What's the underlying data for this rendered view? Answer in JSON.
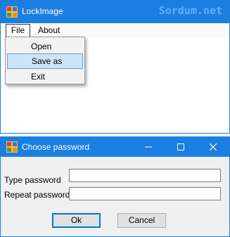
{
  "main_window": {
    "title": "LockImage",
    "watermark": "Sordum.net",
    "menu": {
      "file_label": "File",
      "about_label": "About"
    },
    "file_menu_items": [
      {
        "label": "Open",
        "selected": false
      },
      {
        "label": "Save as",
        "selected": true
      },
      {
        "label": "Exit",
        "selected": false
      }
    ]
  },
  "dialog": {
    "title": "Choose password",
    "type_password_label": "Type password",
    "repeat_password_label": "Repeat password",
    "type_password_value": "",
    "repeat_password_value": "",
    "ok_label": "Ok",
    "cancel_label": "Cancel"
  },
  "colors": {
    "titlebar": "#1a7fe0",
    "menu_highlight": "#cce4f7",
    "dialog_background": "#f0f0f0"
  }
}
